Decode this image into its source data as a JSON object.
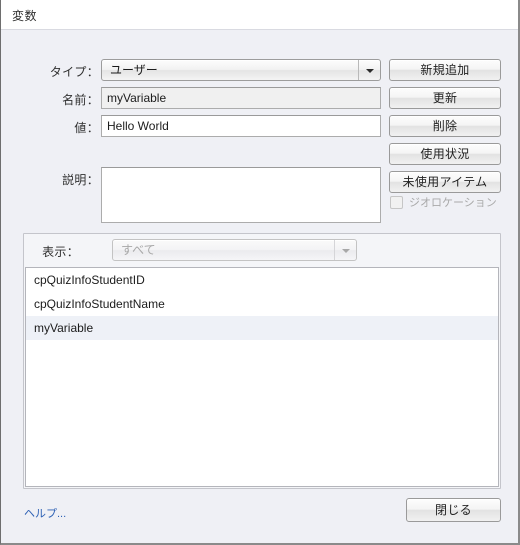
{
  "window": {
    "title": "変数"
  },
  "form": {
    "type_label": "タイプ：",
    "type_value": "ユーザー",
    "name_label": "名前：",
    "name_value": "myVariable",
    "value_label": "値：",
    "value_value": "Hello World",
    "description_label": "説明：",
    "description_value": ""
  },
  "actions": {
    "add_new": "新規追加",
    "update": "更新",
    "delete": "削除",
    "usage": "使用状況",
    "unused_items": "未使用アイテム",
    "geolocation_label": "ジオロケーション",
    "geolocation_checked": false
  },
  "list_panel": {
    "filter_label": "表示：",
    "filter_value": "すべて",
    "items": [
      {
        "label": "cpQuizInfoStudentID",
        "selected": false
      },
      {
        "label": "cpQuizInfoStudentName",
        "selected": false
      },
      {
        "label": "myVariable",
        "selected": true
      }
    ]
  },
  "footer": {
    "help_link": "ヘルプ...",
    "close_button": "閉じる"
  },
  "colors": {
    "window_background": "#eff0f5",
    "titlebar_background": "#ffffff",
    "link": "#2f62b5",
    "selection": "#eef1f7",
    "field_border": "#acacac"
  }
}
